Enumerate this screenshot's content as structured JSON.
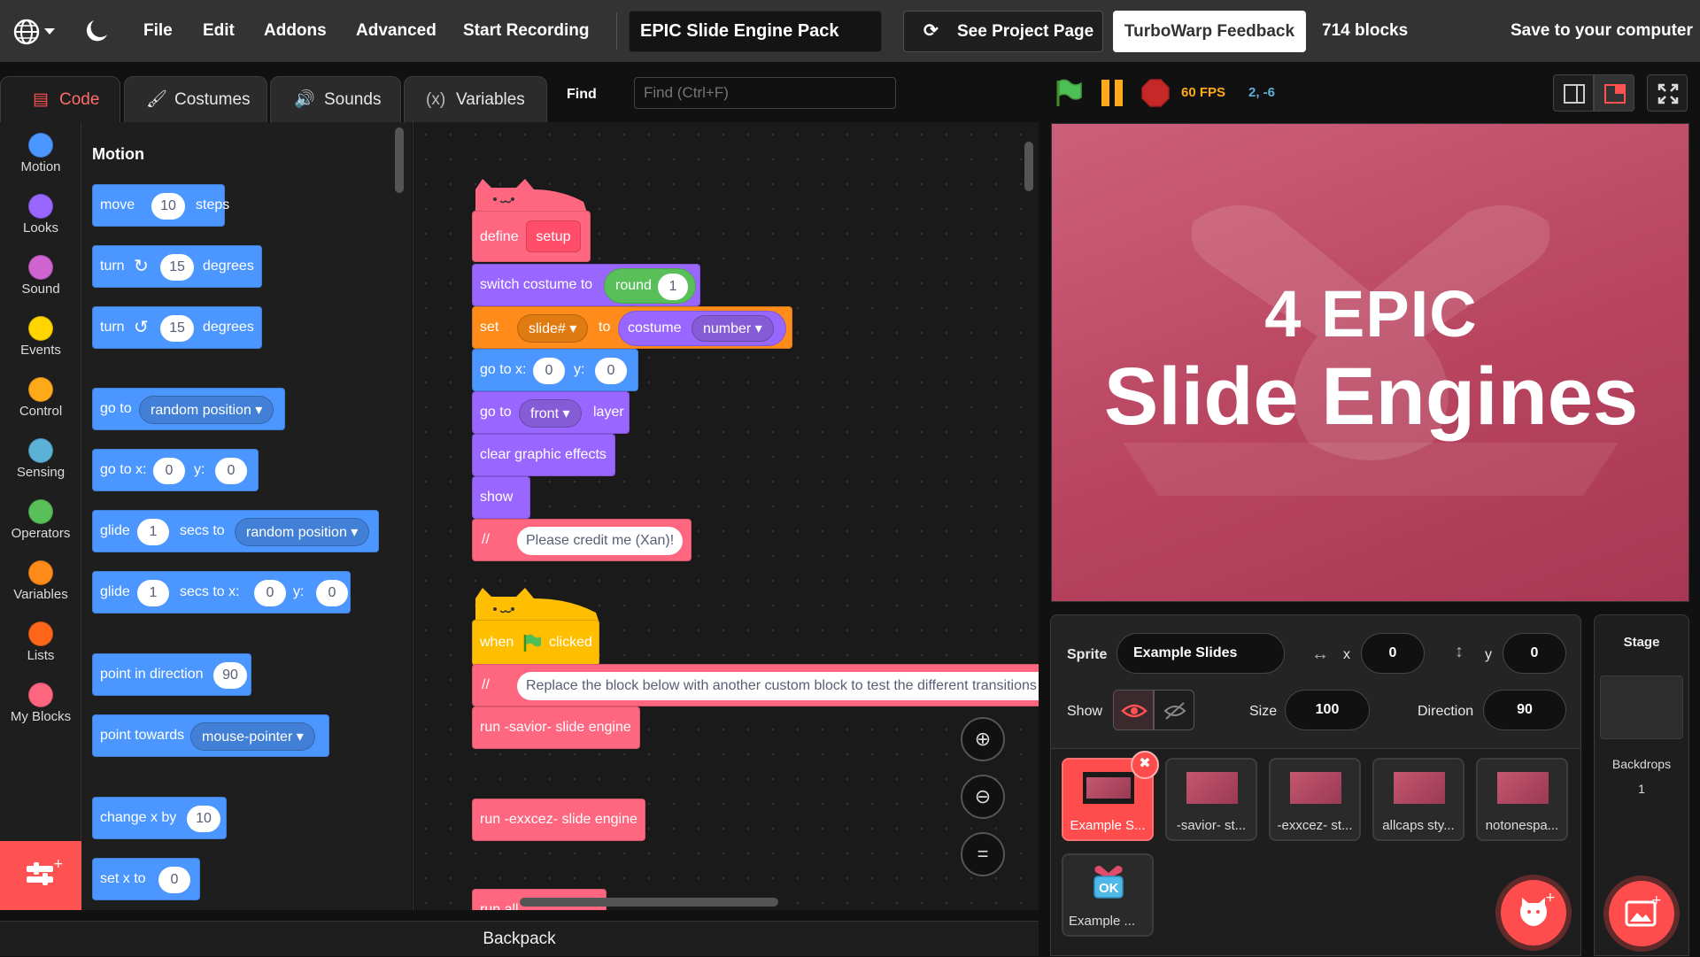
{
  "menubar": {
    "file": "File",
    "edit": "Edit",
    "addons": "Addons",
    "advanced": "Advanced",
    "start_recording": "Start Recording",
    "project_title": "EPIC Slide Engine Pack",
    "see_project": "See Project Page",
    "feedback": "TurboWarp Feedback",
    "block_count": "714 blocks",
    "save": "Save to your computer"
  },
  "tabs": {
    "code": "Code",
    "costumes": "Costumes",
    "sounds": "Sounds",
    "variables": "Variables",
    "find": "Find",
    "find_placeholder": "Find (Ctrl+F)"
  },
  "categories": [
    {
      "label": "Motion",
      "color": "#4c97ff"
    },
    {
      "label": "Looks",
      "color": "#9966ff"
    },
    {
      "label": "Sound",
      "color": "#cf63cf"
    },
    {
      "label": "Events",
      "color": "#ffd500"
    },
    {
      "label": "Control",
      "color": "#ffab19"
    },
    {
      "label": "Sensing",
      "color": "#5cb1d6"
    },
    {
      "label": "Operators",
      "color": "#59c059"
    },
    {
      "label": "Variables",
      "color": "#ff8c1a"
    },
    {
      "label": "Lists",
      "color": "#ff661a"
    },
    {
      "label": "My Blocks",
      "color": "#ff6680"
    }
  ],
  "palette": {
    "heading": "Motion",
    "move": {
      "a": "move",
      "v": "10",
      "b": "steps"
    },
    "turn_right": {
      "a": "turn",
      "v": "15",
      "b": "degrees"
    },
    "turn_left": {
      "a": "turn",
      "v": "15",
      "b": "degrees"
    },
    "goto": {
      "a": "go to",
      "v": "random position"
    },
    "goto_xy": {
      "a": "go to x:",
      "x": "0",
      "b": "y:",
      "y": "0"
    },
    "glide": {
      "a": "glide",
      "s": "1",
      "b": "secs to",
      "v": "random position"
    },
    "glide_xy": {
      "a": "glide",
      "s": "1",
      "b": "secs to x:",
      "x": "0",
      "c": "y:",
      "y": "0"
    },
    "point_dir": {
      "a": "point in direction",
      "v": "90"
    },
    "point_towards": {
      "a": "point towards",
      "v": "mouse-pointer"
    },
    "change_x": {
      "a": "change x by",
      "v": "10"
    },
    "set_x": {
      "a": "set x to",
      "v": "0"
    }
  },
  "script": {
    "define": "define",
    "define_name": "setup",
    "switch_costume": "switch costume to",
    "costume_val": "round",
    "costume_num": "1",
    "set": "set",
    "set_var": "slide#",
    "to": "to",
    "costume": "costume",
    "costume_attr": "number",
    "goto_x": "go to x:",
    "x_val": "0",
    "y_lbl": "y:",
    "y_val": "0",
    "goto": "go to",
    "layer_val": "front",
    "layer": "layer",
    "clear": "clear graphic effects",
    "show": "show",
    "comment_mark": "//",
    "credit": "Please credit me (Xan)!",
    "when": "when",
    "clicked": "clicked",
    "comment2": "Replace the block below with another custom block to test the different transitions",
    "run_savior": "run -savior- slide engine",
    "run_exxcez": "run -exxcez- slide engine",
    "run_partial": "run all"
  },
  "stage": {
    "fps": "60 FPS",
    "coords": "2, -6",
    "line1": "4 EPIC",
    "line2": "Slide Engines"
  },
  "sprite_info": {
    "sprite_label": "Sprite",
    "sprite_name": "Example Slides",
    "x_label": "x",
    "x": "0",
    "y_label": "y",
    "y": "0",
    "show_label": "Show",
    "size_label": "Size",
    "size": "100",
    "direction_label": "Direction",
    "direction": "90"
  },
  "sprites": [
    {
      "name": "Example S..."
    },
    {
      "name": "-savior- st..."
    },
    {
      "name": "-exxcez- st..."
    },
    {
      "name": "allcaps sty..."
    },
    {
      "name": "notonespa..."
    },
    {
      "name": "Example ..."
    }
  ],
  "ok_badge": "OK",
  "stage_pane": {
    "title": "Stage",
    "backdrops_label": "Backdrops",
    "backdrops": "1"
  },
  "backpack": "Backpack",
  "colors": {
    "accent": "#ff4d4d",
    "bar": "#333333"
  }
}
